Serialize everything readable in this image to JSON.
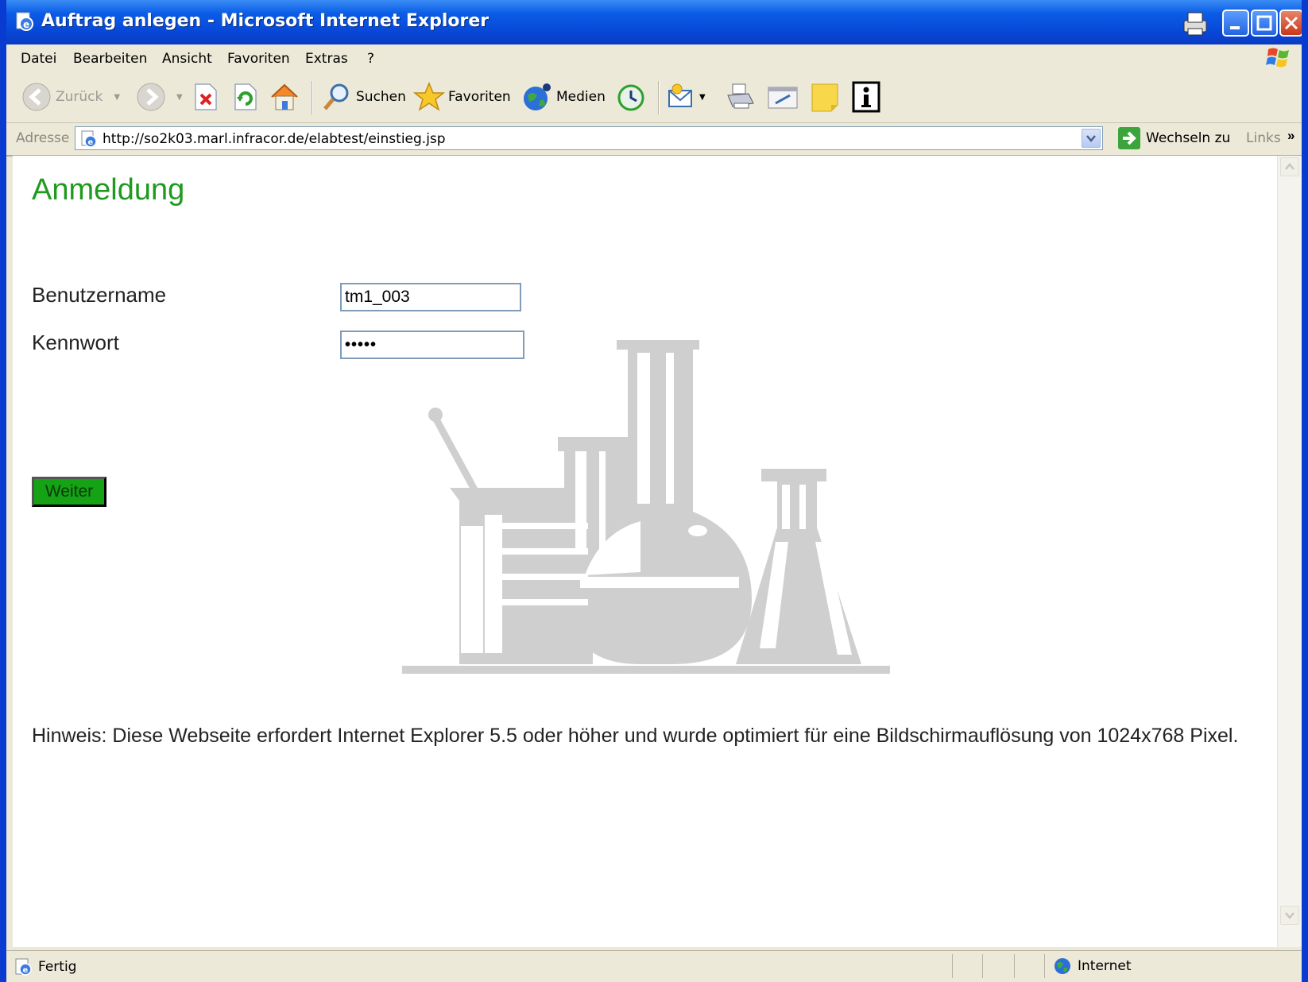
{
  "window": {
    "title": "Auftrag anlegen - Microsoft Internet Explorer"
  },
  "menu": [
    "Datei",
    "Bearbeiten",
    "Ansicht",
    "Favoriten",
    "Extras",
    "?"
  ],
  "toolbar": {
    "back_label": "Zurück",
    "search_label": "Suchen",
    "favorites_label": "Favoriten",
    "media_label": "Medien"
  },
  "address": {
    "label": "Adresse",
    "url": "http://so2k03.marl.infracor.de/elabtest/einstieg.jsp",
    "go_label": "Wechseln zu",
    "links_label": "Links",
    "more": "»"
  },
  "page": {
    "title": "Anmeldung",
    "username_label": "Benutzername",
    "username_value": "tm1_003",
    "password_label": "Kennwort",
    "password_value": "•••••",
    "submit_label": "Weiter",
    "hint": "Hinweis: Diese Webseite erfordert Internet Explorer 5.5 oder höher und wurde optimiert für eine Bildschirmauflösung von 1024x768 Pixel."
  },
  "status": {
    "text": "Fertig",
    "zone": "Internet"
  },
  "colors": {
    "accent": "#1E9A1E",
    "button": "#15A215",
    "titlebar": "#0848D8"
  }
}
